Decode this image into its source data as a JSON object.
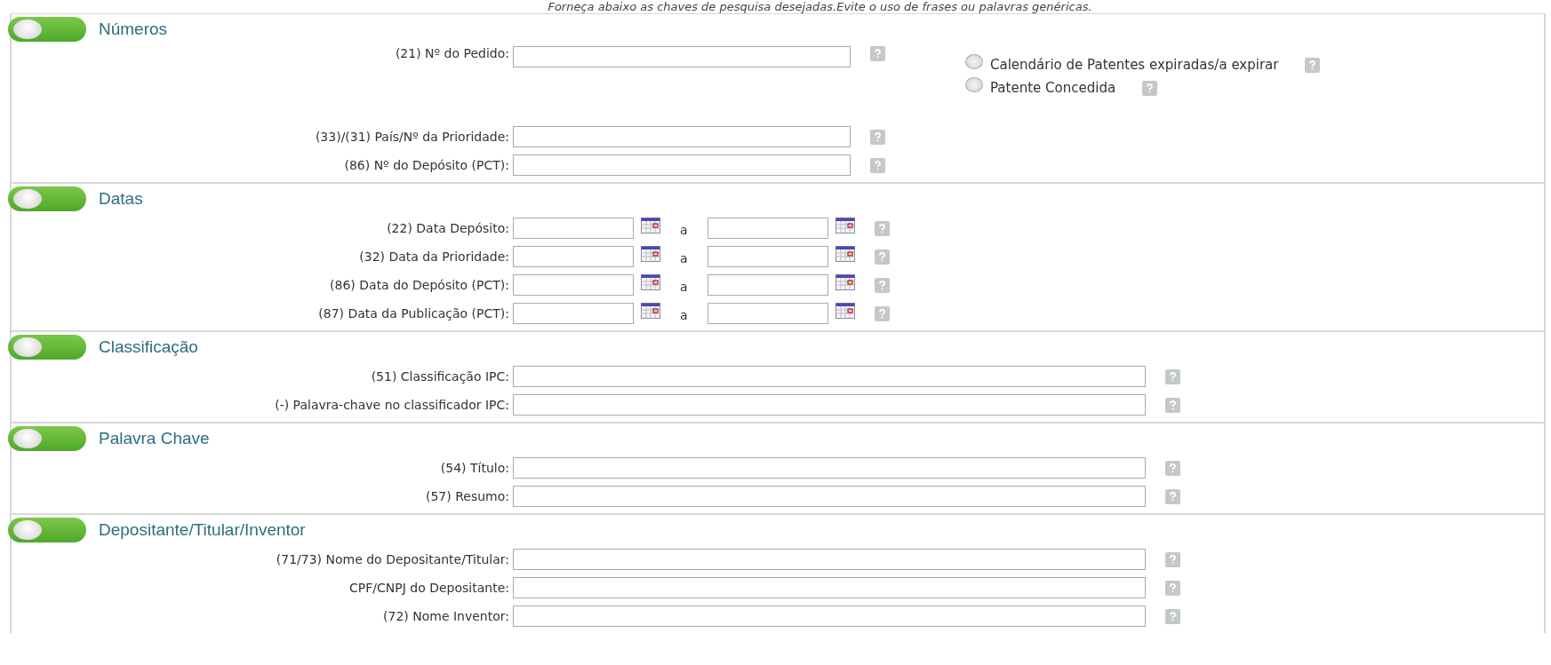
{
  "hint": "Forneça abaixo as chaves de pesquisa desejadas.Evite o uso de frases ou palavras genéricas.",
  "sections": [
    {
      "title": "Números",
      "on": true,
      "fields": [
        {
          "kind": "short",
          "label": "(21) Nº do Pedido:"
        },
        {
          "kind": "short",
          "label": "(33)/(31)  País/Nº da Prioridade:"
        },
        {
          "kind": "short",
          "label": "(86)  Nº do Depósito (PCT):"
        }
      ],
      "options": [
        {
          "label": "Calendário de Patentes expiradas/a expirar",
          "selected": false
        },
        {
          "label": "Patente Concedida",
          "selected": false
        }
      ]
    },
    {
      "title": "Datas",
      "on": true,
      "fields": [
        {
          "kind": "date-range",
          "label": "(22) Data Depósito:",
          "joiner": "a"
        },
        {
          "kind": "date-range",
          "label": "(32)  Data da Prioridade:",
          "joiner": "a"
        },
        {
          "kind": "date-range",
          "label": "(86) Data do Depósito (PCT):",
          "joiner": "a"
        },
        {
          "kind": "date-range",
          "label": "(87) Data da Publicação (PCT):",
          "joiner": "a"
        }
      ]
    },
    {
      "title": "Classificação",
      "on": true,
      "fields": [
        {
          "kind": "long",
          "label": "(51)  Classificação IPC:"
        },
        {
          "kind": "long",
          "label": "(-)  Palavra-chave no classificador IPC:"
        }
      ]
    },
    {
      "title": "Palavra Chave",
      "on": true,
      "fields": [
        {
          "kind": "long",
          "label": "(54)  Título:"
        },
        {
          "kind": "long",
          "label": "(57)  Resumo:"
        }
      ]
    },
    {
      "title": "Depositante/Titular/Inventor",
      "on": true,
      "fields": [
        {
          "kind": "long",
          "label": "(71/73)  Nome do Depositante/Titular:"
        },
        {
          "kind": "long",
          "label": "CPF/CNPJ do Depositante:"
        },
        {
          "kind": "long",
          "label": "(72)  Nome Inventor:"
        }
      ]
    }
  ]
}
